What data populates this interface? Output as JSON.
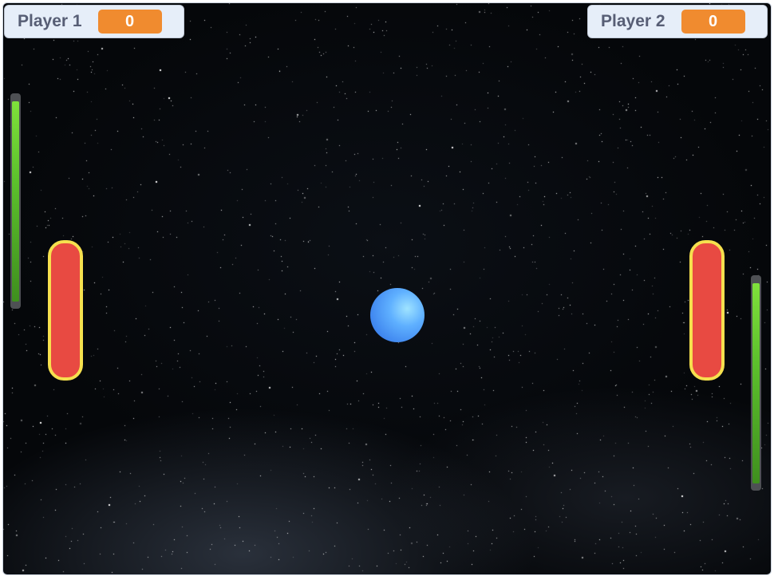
{
  "scoreboard": {
    "player1": {
      "label": "Player 1",
      "score": "0"
    },
    "player2": {
      "label": "Player 2",
      "score": "0"
    }
  },
  "power_bars": {
    "player1": {
      "level_fraction": 0.97
    },
    "player2": {
      "level_fraction": 0.97
    }
  },
  "colors": {
    "monitor_value_bg": "#f08b2f",
    "monitor_bg": "#e6eef9",
    "paddle_fill": "#e84a42",
    "paddle_border": "#f6e04e",
    "ball": "#4a9af5",
    "power_bar": "#5cc02c",
    "background": "#05070a"
  }
}
